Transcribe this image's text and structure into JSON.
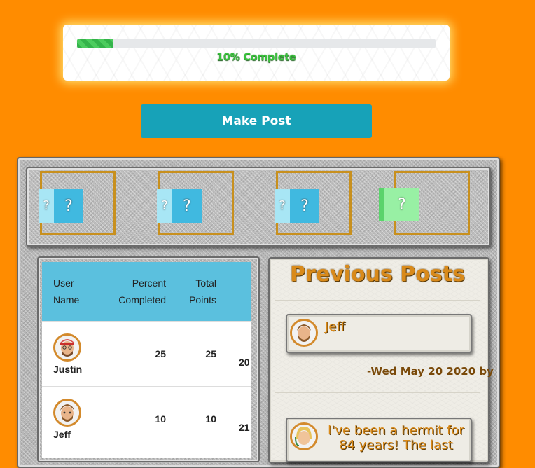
{
  "progress": {
    "percent": 10,
    "label": "10% Complete"
  },
  "actions": {
    "make_post_label": "Make Post"
  },
  "badges": [
    {
      "color": "blue",
      "side_glyph": "?",
      "front_glyph": "?"
    },
    {
      "color": "blue",
      "side_glyph": "?",
      "front_glyph": "?"
    },
    {
      "color": "blue",
      "side_glyph": "?",
      "front_glyph": "?"
    },
    {
      "color": "green",
      "side_glyph": "",
      "front_glyph": "?"
    }
  ],
  "leaderboard": {
    "columns": {
      "user_line1": "User",
      "user_line2": "Name",
      "percent_line1": "Percent",
      "percent_line2": "Completed",
      "total_line1": "Total",
      "total_line2": "Points"
    },
    "rows": [
      {
        "name": "Justin",
        "percent": "25",
        "points": "25",
        "extra": "20"
      },
      {
        "name": "Jeff",
        "percent": "10",
        "points": "10",
        "extra": "21"
      }
    ]
  },
  "previous_posts": {
    "title": "Previous Posts",
    "posts": [
      {
        "text": "Jeff",
        "meta": "-Wed May 20 2020 by"
      },
      {
        "text_line1": "I've been a hermit for",
        "text_line2": "84 years! The last"
      }
    ]
  },
  "colors": {
    "background": "#ff8c00",
    "accent_teal": "#17a2b8",
    "header_blue": "#5bc0de",
    "gold": "#d98a1a",
    "progress_green": "#39c33c"
  }
}
